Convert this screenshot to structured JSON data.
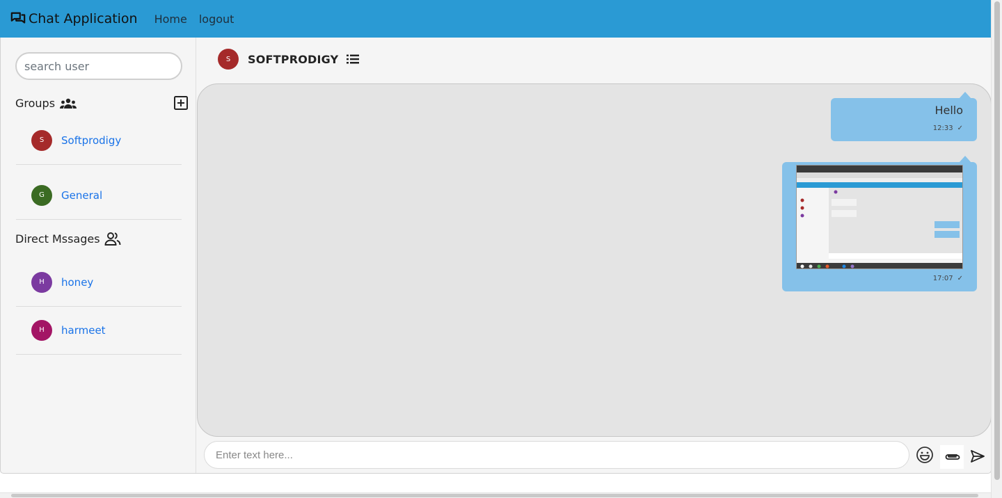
{
  "navbar": {
    "brand": "Chat Application",
    "links": {
      "home": "Home",
      "logout": "logout"
    },
    "bg_color": "#2a9ad4"
  },
  "sidebar": {
    "search_placeholder": "search user",
    "groups_title": "Groups",
    "groups": [
      {
        "initial": "S",
        "name": "Softprodigy",
        "color": "#a52a2a"
      },
      {
        "initial": "G",
        "name": "General",
        "color": "#3b6b23"
      }
    ],
    "direct_title": "Direct Mssages",
    "direct": [
      {
        "initial": "H",
        "name": "honey",
        "color": "#7b3aa0"
      },
      {
        "initial": "H",
        "name": "harmeet",
        "color": "#a31565"
      }
    ]
  },
  "chat": {
    "header": {
      "initial": "S",
      "name": "SOFTPRODIGY",
      "color": "#a52a2a"
    },
    "messages": [
      {
        "type": "text",
        "text": "Hello",
        "time": "12:33",
        "status": "✓"
      },
      {
        "type": "image",
        "time": "17:07",
        "status": "✓"
      }
    ],
    "bubble_color": "#85c1e9",
    "input_placeholder": "Enter text here..."
  },
  "icons": {
    "brand": "chat-bubbles-icon",
    "groups": "group-icon",
    "add_group": "plus-square-icon",
    "direct": "users-icon",
    "list": "list-icon",
    "emoji": "emoji-icon",
    "attach": "paperclip-icon",
    "send": "send-icon"
  }
}
